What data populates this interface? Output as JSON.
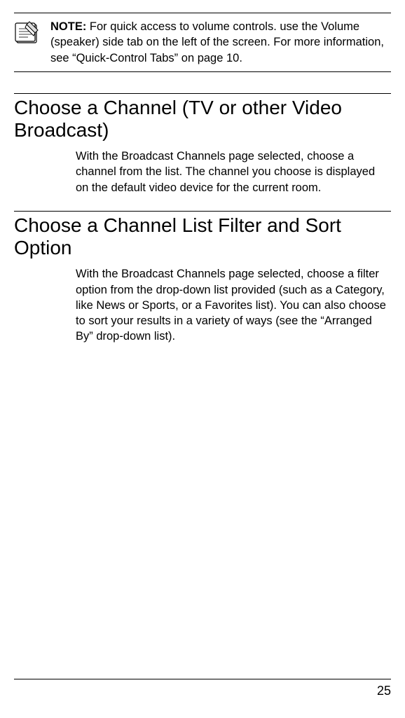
{
  "note": {
    "label": "NOTE:",
    "text": "  For quick access to volume controls. use the Volume (speaker) side tab on the left of the screen. For more information, see “Quick-Control Tabs” on page 10."
  },
  "sections": [
    {
      "heading": "Choose a Channel (TV or other Video Broadcast)",
      "body": "With the Broadcast Channels page selected, choose a channel from the list. The channel you choose is displayed on the default video device for the current room."
    },
    {
      "heading": "Choose a Channel List Filter and Sort Option",
      "body": "With the Broadcast Channels page selected, choose a filter option from the drop-down list provided (such as a Category, like News or Sports, or a Favorites list). You can also choose to sort your results in a variety of ways (see the “Arranged By” drop-down list)."
    }
  ],
  "pageNumber": "25"
}
